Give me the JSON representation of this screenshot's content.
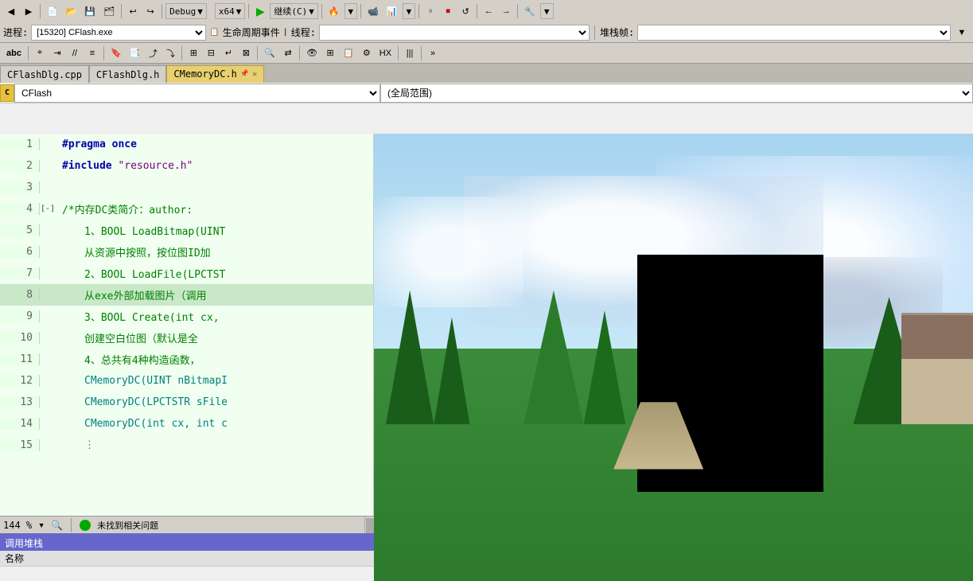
{
  "toolbar": {
    "back_btn": "◀",
    "forward_btn": "▶",
    "debug_label": "Debug",
    "platform_label": "x64",
    "continue_label": "继续(C)",
    "pause_icon": "⏸",
    "stop_icon": "⏹",
    "restart_icon": "↺"
  },
  "process_bar": {
    "process_label": "进程:",
    "process_value": "[15320] CFlash.exe",
    "lifecycle_label": "生命周期事件",
    "thread_label": "线程:",
    "thread_value": "",
    "stack_label": "堆栈帧:",
    "stack_value": ""
  },
  "tabs": [
    {
      "id": "tab1",
      "label": "CFlashDlg.cpp",
      "active": false,
      "modified": false
    },
    {
      "id": "tab2",
      "label": "CFlashDlg.h",
      "active": false,
      "modified": false
    },
    {
      "id": "tab3",
      "label": "CMemoryDC.h",
      "active": true,
      "modified": true,
      "pinned": true
    }
  ],
  "scope": {
    "left_value": "CFlash",
    "right_value": "(全局范围)"
  },
  "code_lines": [
    {
      "num": 1,
      "content": "#pragma once",
      "type": "pragma"
    },
    {
      "num": 2,
      "content": "#include \"resource.h\"",
      "type": "include"
    },
    {
      "num": 3,
      "content": "",
      "type": "empty"
    },
    {
      "num": 4,
      "content": "/*内存DC类简介：author:",
      "type": "comment",
      "collapsible": true,
      "collapsed": true
    },
    {
      "num": 5,
      "content": "1、BOOL LoadBitmap(UINT",
      "type": "comment"
    },
    {
      "num": 6,
      "content": "从资源中按照，按位图ID加",
      "type": "comment"
    },
    {
      "num": 7,
      "content": "2、BOOL LoadFile(LPCTST",
      "type": "comment"
    },
    {
      "num": 8,
      "content": "从exe外部加载图片（调用",
      "type": "comment",
      "highlighted": true
    },
    {
      "num": 9,
      "content": "3、BOOL Create(int cx,",
      "type": "comment"
    },
    {
      "num": 10,
      "content": "创建空白位图（默认是全",
      "type": "comment"
    },
    {
      "num": 11,
      "content": "4、总共有4种构造函数，",
      "type": "comment"
    },
    {
      "num": 12,
      "content": "CMemoryDC(UINT nBitmapI",
      "type": "normal"
    },
    {
      "num": 13,
      "content": "CMemoryDC(LPCTSTR sFile",
      "type": "normal"
    },
    {
      "num": 14,
      "content": "CMemoryDC(int cx, int c",
      "type": "normal"
    },
    {
      "num": 15,
      "content": "⋮",
      "type": "ellipsis"
    }
  ],
  "status": {
    "zoom": "144 %",
    "zoom_icon": "🔍",
    "status_icon_color": "#00aa00",
    "status_text": "未找到相关问题"
  },
  "callstack": {
    "title": "调用堆栈",
    "column_name": "名称"
  },
  "image_overlay": {
    "black_rect": true
  }
}
